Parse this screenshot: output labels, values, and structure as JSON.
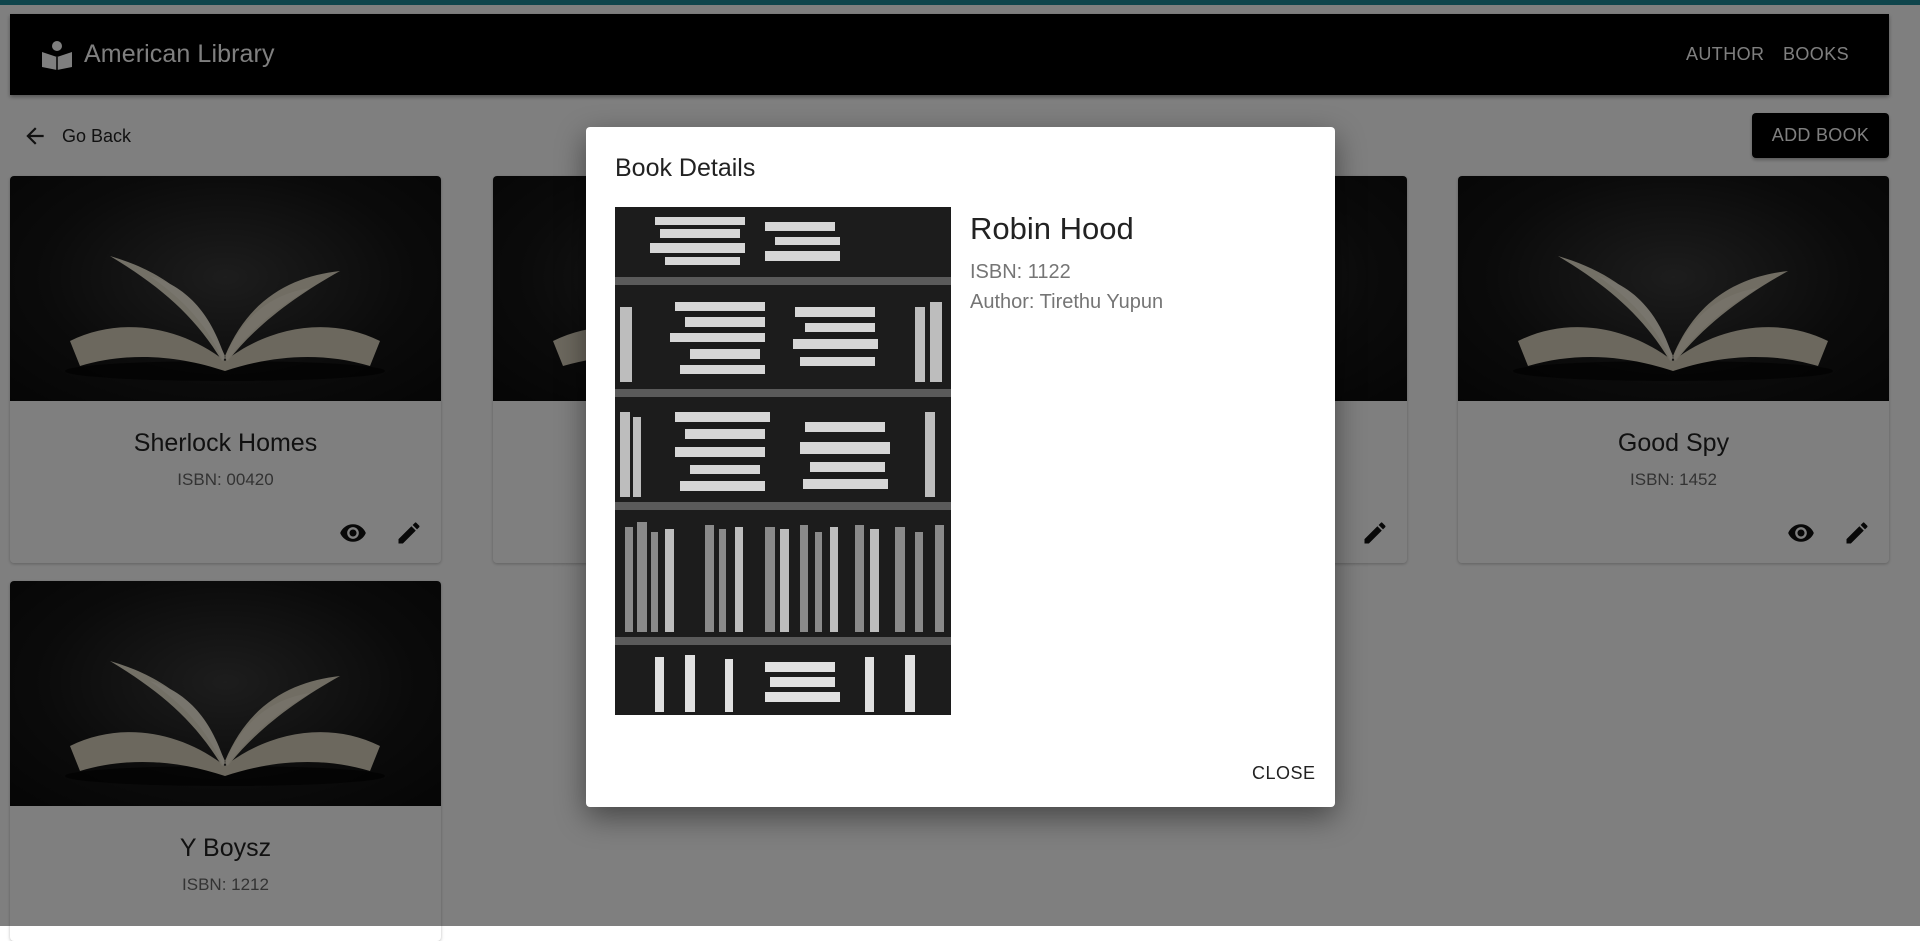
{
  "app": {
    "title": "American Library",
    "logo_icon": "book-reader-icon"
  },
  "nav": {
    "author": "AUTHOR",
    "books": "BOOKS"
  },
  "toolbar": {
    "go_back": "Go Back",
    "add_book": "ADD BOOK"
  },
  "cards": [
    {
      "title": "Sherlock Homes",
      "isbn": "ISBN: 00420"
    },
    {
      "title": "Good Spy",
      "isbn": "ISBN: 1452"
    },
    {
      "title": "Y Boysz",
      "isbn": "ISBN: 1212"
    }
  ],
  "dialog": {
    "title": "Book Details",
    "book_name": "Robin Hood",
    "isbn": "ISBN: 1122",
    "author": "Author: Tirethu Yupun",
    "close": "CLOSE"
  },
  "colors": {
    "accent_strip": "#1f8a98",
    "appbar": "#000000",
    "button": "#000000"
  }
}
